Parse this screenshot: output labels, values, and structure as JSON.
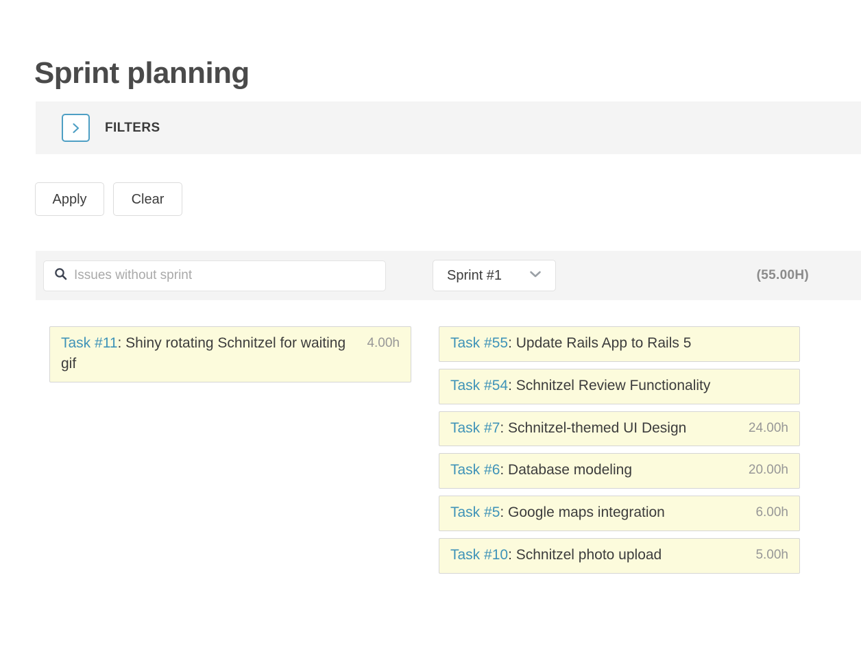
{
  "header": {
    "title": "Sprint planning"
  },
  "filters": {
    "label": "FILTERS",
    "toggle_icon": "chevron-right-icon",
    "expanded": false,
    "accent_color": "#4e9fc4",
    "band_color": "#f4f4f4"
  },
  "actions": {
    "apply_label": "Apply",
    "clear_label": "Clear"
  },
  "toolbar": {
    "search": {
      "icon": "search-icon",
      "value": "",
      "placeholder": "Issues without sprint"
    },
    "sprint_select": {
      "selected": "Sprint #1",
      "icon": "chevron-down-icon",
      "options": [
        "Sprint #1"
      ]
    },
    "hours_total": "(55.00H)"
  },
  "columns": {
    "backlog": {
      "tasks": [
        {
          "id": "Task #11",
          "separator": ": ",
          "title": "Shiny rotating Schnitzel for waiting gif",
          "hours": "4.00h"
        }
      ]
    },
    "sprint": {
      "tasks": [
        {
          "id": "Task #55",
          "separator": ": ",
          "title": "Update Rails App to Rails 5",
          "hours": ""
        },
        {
          "id": "Task #54",
          "separator": ": ",
          "title": "Schnitzel Review Functionality",
          "hours": ""
        },
        {
          "id": "Task #7",
          "separator": ": ",
          "title": "Schnitzel-themed UI Design",
          "hours": "24.00h"
        },
        {
          "id": "Task #6",
          "separator": ": ",
          "title": "Database modeling",
          "hours": "20.00h"
        },
        {
          "id": "Task #5",
          "separator": ": ",
          "title": "Google maps integration",
          "hours": "6.00h"
        },
        {
          "id": "Task #10",
          "separator": ": ",
          "title": "Schnitzel photo upload",
          "hours": "5.00h"
        }
      ]
    }
  },
  "colors": {
    "card_background": "#fcfbdc",
    "card_border": "#d5d5d5",
    "task_link": "#3f93b8",
    "text": "#3c3c3c",
    "muted": "#979797"
  }
}
